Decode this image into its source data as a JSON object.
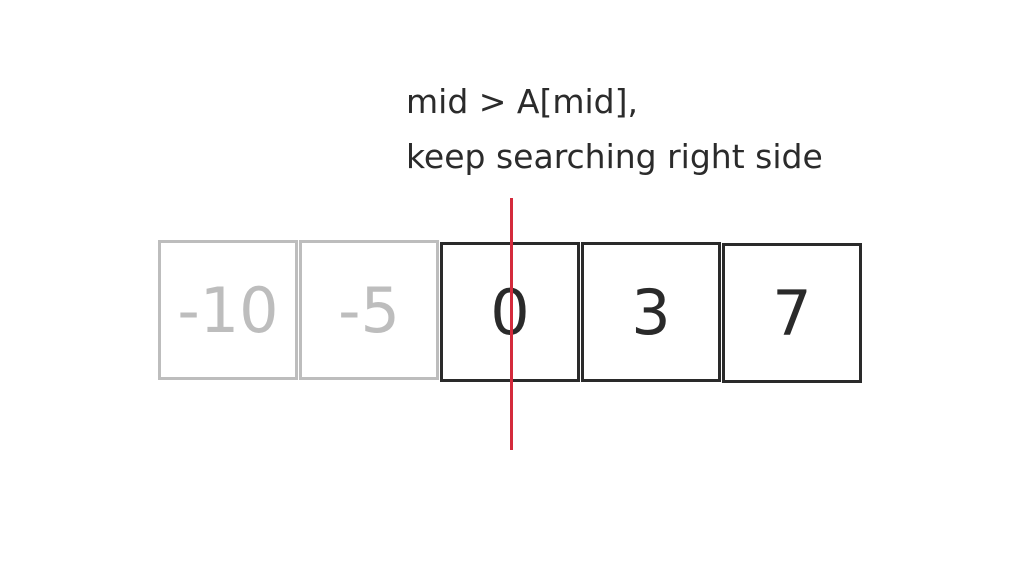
{
  "caption": {
    "line1": "mid > A[mid],",
    "line2": "keep searching right side"
  },
  "array": {
    "cells": [
      {
        "value": "-10",
        "state": "excluded"
      },
      {
        "value": "-5",
        "state": "excluded"
      },
      {
        "value": "0",
        "state": "active"
      },
      {
        "value": "3",
        "state": "active"
      },
      {
        "value": "7",
        "state": "active"
      }
    ]
  },
  "colors": {
    "active": "#2a2a2a",
    "excluded": "#bdbdbd",
    "mid_marker": "#d42a3c",
    "background": "#ffffff"
  }
}
